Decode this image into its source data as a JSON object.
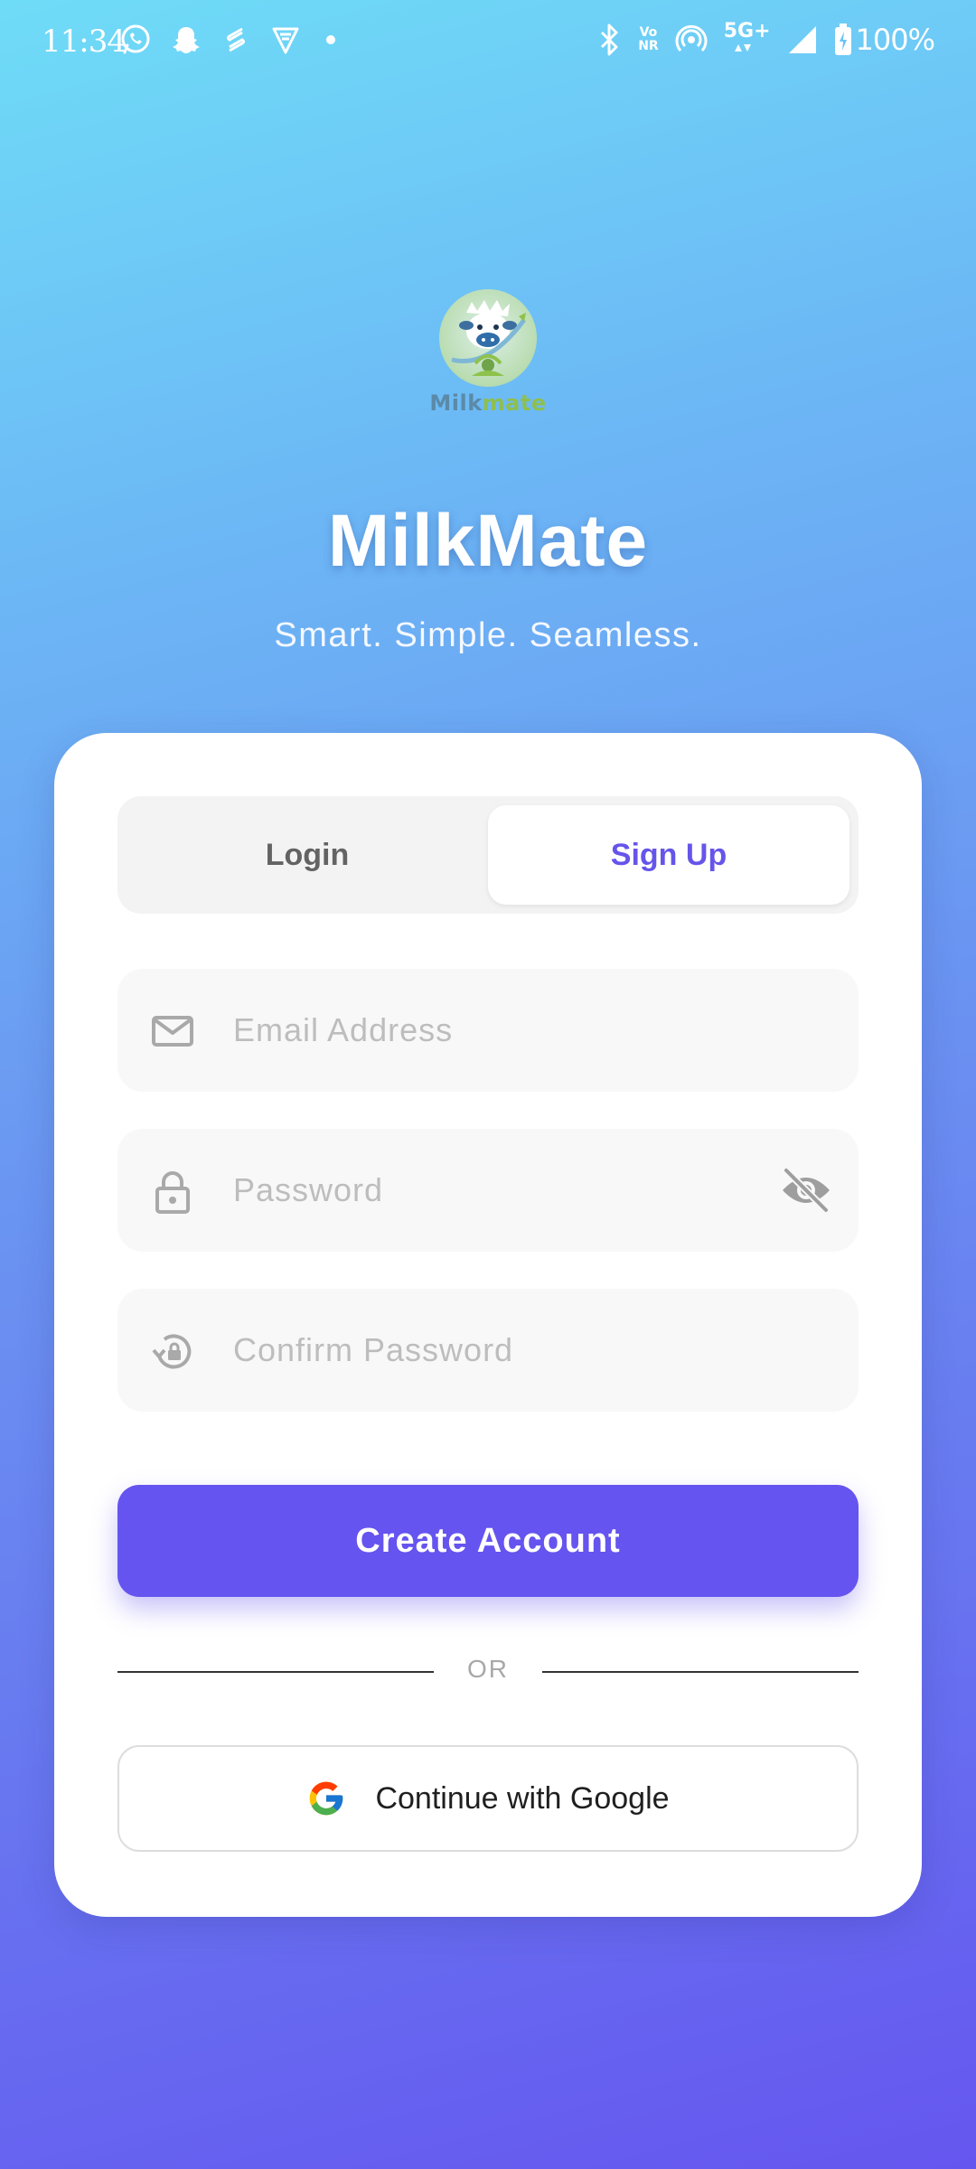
{
  "status_bar": {
    "time": "11:34",
    "left_icons": [
      "whatsapp-icon",
      "snapchat-icon",
      "sync-app-icon",
      "vpn-icon",
      "dot-icon"
    ],
    "right_icons": [
      "bluetooth-icon",
      "vonr-icon",
      "hotspot-icon",
      "network-5g-icon",
      "signal-icon",
      "battery-charging-icon"
    ],
    "vonr_top": "Vo",
    "vonr_bottom": "NR",
    "network": "5G+",
    "battery": "100%"
  },
  "brand": {
    "logo_part1": "Milk",
    "logo_part2": "mate",
    "title": "MilkMate",
    "tagline": "Smart. Simple. Seamless."
  },
  "auth": {
    "tabs": [
      {
        "label": "Login",
        "active": false
      },
      {
        "label": "Sign Up",
        "active": true
      }
    ],
    "fields": {
      "email": {
        "placeholder": "Email Address",
        "value": "",
        "icon": "mail-icon"
      },
      "password": {
        "placeholder": "Password",
        "value": "",
        "icon": "lock-icon",
        "toggle_icon": "eye-off-icon"
      },
      "confirm_password": {
        "placeholder": "Confirm Password",
        "value": "",
        "icon": "lock-reset-icon"
      }
    },
    "submit_label": "Create Account",
    "divider_text": "OR",
    "google_label": "Continue with Google"
  },
  "colors": {
    "accent": "#6554EF",
    "gradient_top": "#6FDCF7",
    "gradient_bottom": "#6556EF",
    "placeholder": "#BDBDBD"
  }
}
